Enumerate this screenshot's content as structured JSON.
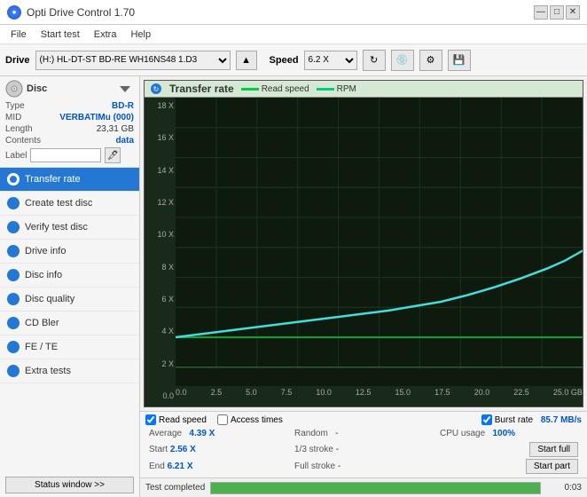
{
  "titleBar": {
    "title": "Opti Drive Control 1.70",
    "icon": "🔵",
    "controls": {
      "minimize": "—",
      "maximize": "□",
      "close": "✕"
    }
  },
  "menuBar": {
    "items": [
      "File",
      "Start test",
      "Extra",
      "Help"
    ]
  },
  "driveBar": {
    "label": "Drive",
    "driveValue": "(H:) HL-DT-ST BD-RE  WH16NS48 1.D3",
    "speedLabel": "Speed",
    "speedValue": "6.2 X"
  },
  "discPanel": {
    "title": "Disc",
    "rows": [
      {
        "key": "Type",
        "value": "BD-R",
        "colored": true
      },
      {
        "key": "MID",
        "value": "VERBATIMu (000)",
        "colored": true
      },
      {
        "key": "Length",
        "value": "23,31 GB",
        "colored": false
      },
      {
        "key": "Contents",
        "value": "data",
        "colored": true
      }
    ],
    "labelKey": "Label"
  },
  "navItems": [
    {
      "id": "transfer-rate",
      "label": "Transfer rate",
      "active": true
    },
    {
      "id": "create-test-disc",
      "label": "Create test disc",
      "active": false
    },
    {
      "id": "verify-test-disc",
      "label": "Verify test disc",
      "active": false
    },
    {
      "id": "drive-info",
      "label": "Drive info",
      "active": false
    },
    {
      "id": "disc-info",
      "label": "Disc info",
      "active": false
    },
    {
      "id": "disc-quality",
      "label": "Disc quality",
      "active": false
    },
    {
      "id": "cd-bler",
      "label": "CD Bler",
      "active": false
    },
    {
      "id": "fe-te",
      "label": "FE / TE",
      "active": false
    },
    {
      "id": "extra-tests",
      "label": "Extra tests",
      "active": false
    }
  ],
  "statusBtn": "Status window >>",
  "chart": {
    "title": "Transfer rate",
    "legendReadSpeed": "Read speed",
    "legendRPM": "RPM",
    "readSpeedColor": "#00cc44",
    "rpmColor": "#00aa88",
    "yLabels": [
      "18 X",
      "16 X",
      "14 X",
      "12 X",
      "10 X",
      "8 X",
      "6 X",
      "4 X",
      "2 X",
      "0.0"
    ],
    "xLabels": [
      "0.0",
      "2.5",
      "5.0",
      "7.5",
      "10.0",
      "12.5",
      "15.0",
      "17.5",
      "20.0",
      "22.5",
      "25.0 GB"
    ]
  },
  "checkboxes": {
    "readSpeed": {
      "label": "Read speed",
      "checked": true
    },
    "accessTimes": {
      "label": "Access times",
      "checked": false
    },
    "burstRate": {
      "label": "Burst rate",
      "checked": true
    },
    "burstValue": "85.7 MB/s"
  },
  "stats": {
    "averageLabel": "Average",
    "averageValue": "4.39 X",
    "randomLabel": "Random",
    "randomValue": "-",
    "cpuLabel": "CPU usage",
    "cpuValue": "100%",
    "startLabel": "Start",
    "startValue": "2.56 X",
    "strokeLabel": "1/3 stroke",
    "strokeValue": "-",
    "startFullBtn": "Start full",
    "endLabel": "End",
    "endValue": "6.21 X",
    "fullStrokeLabel": "Full stroke",
    "fullStrokeValue": "-",
    "startPartBtn": "Start part"
  },
  "statusBar": {
    "text": "Test completed",
    "progress": 100,
    "timer": "0:03"
  }
}
